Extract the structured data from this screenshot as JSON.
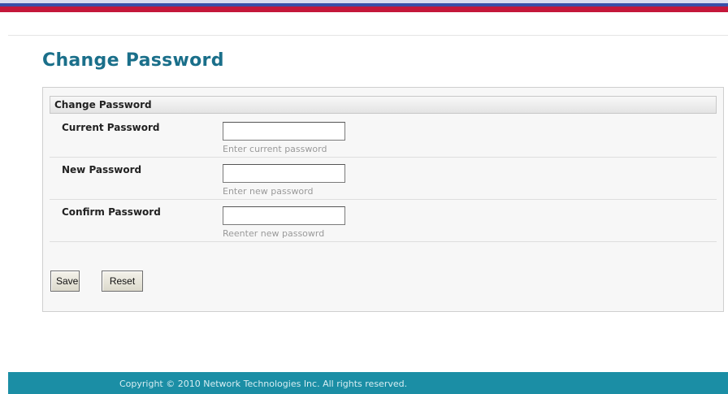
{
  "colors": {
    "title": "#1a6f8a",
    "footer_bg": "#1b8ea5",
    "stripe_blue": "#3a4fa8",
    "stripe_red": "#c4173a"
  },
  "page": {
    "title": "Change Password"
  },
  "panel": {
    "header": "Change Password",
    "fields": [
      {
        "label": "Current Password",
        "value": "",
        "hint": "Enter current password"
      },
      {
        "label": "New Password",
        "value": "",
        "hint": "Enter new password"
      },
      {
        "label": "Confirm Password",
        "value": "",
        "hint": "Reenter new passowrd"
      }
    ],
    "buttons": {
      "save": "Save",
      "reset": "Reset"
    }
  },
  "footer": {
    "copyright": "Copyright © 2010 Network Technologies Inc. All rights reserved."
  }
}
